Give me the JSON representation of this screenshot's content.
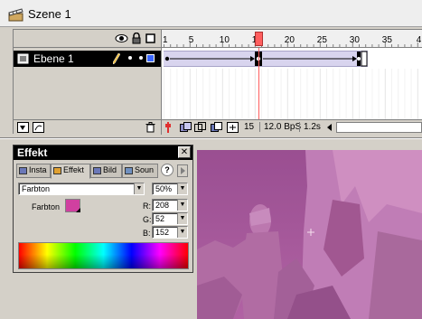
{
  "scene": {
    "title": "Szene 1",
    "icon": "scene-clapper-icon"
  },
  "timeline": {
    "header_icons": [
      "eye-icon",
      "lock-icon",
      "outline-square-icon"
    ],
    "layer": {
      "name": "Ebene 1",
      "icon": "layer-page-icon",
      "edit_icon": "pencil-icon",
      "color": "#3a66ff"
    },
    "ruler_numbers": [
      "1",
      "5",
      "10",
      "15",
      "20",
      "25",
      "30",
      "35",
      "4"
    ],
    "current_frame": 15,
    "playhead_color": "#ff5f5f",
    "footer_icons": [
      "add-layer-icon",
      "add-guide-layer-icon",
      "trash-icon"
    ],
    "status": {
      "frame": "15",
      "fps": "12.0 BpS",
      "time": "1.2s"
    }
  },
  "effekt": {
    "title": "Effekt",
    "tabs": [
      {
        "label": "Insta",
        "icon": "instance-icon"
      },
      {
        "label": "Effekt",
        "icon": "effect-icon",
        "active": true
      },
      {
        "label": "Bild",
        "icon": "frame-icon"
      },
      {
        "label": "Soun",
        "icon": "sound-icon"
      }
    ],
    "effect_type": "Farbton",
    "percent": "50%",
    "color_label": "Farbton",
    "tint_color": "#d040a0",
    "r_label": "R:",
    "r_value": "208",
    "g_label": "G:",
    "g_value": "52",
    "b_label": "B:",
    "b_value": "152"
  },
  "stage": {
    "overlay_color": "#c8449a"
  }
}
